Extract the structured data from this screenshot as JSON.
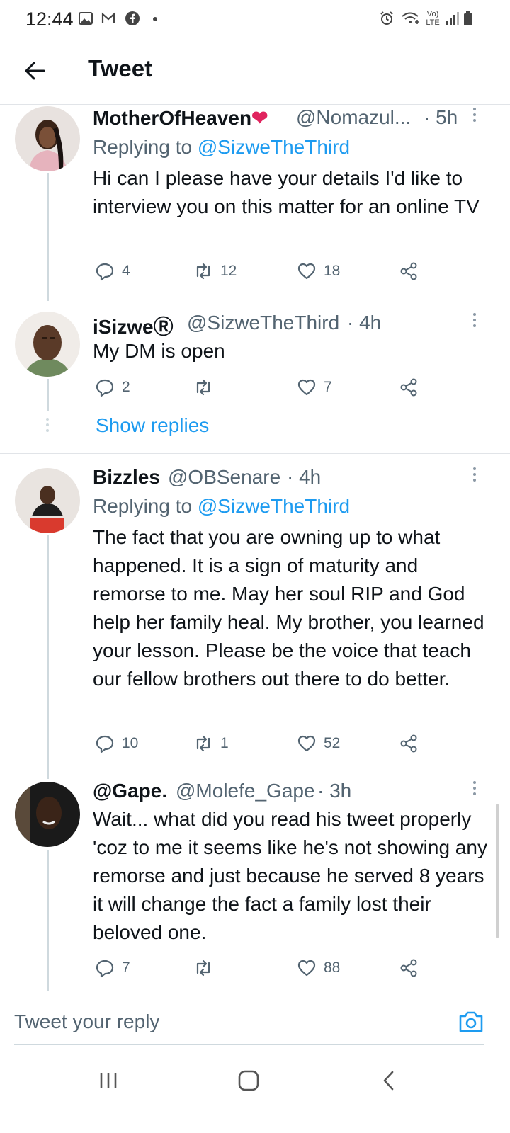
{
  "status_bar": {
    "time": "12:44",
    "left_icons": [
      "gallery-icon",
      "gmail-icon",
      "facebook-icon",
      "dot-icon"
    ],
    "right_icons": [
      "alarm-icon",
      "wifi-icon",
      "volte-icon",
      "signal-icon",
      "battery-icon"
    ],
    "volte_label": "Vo) LTE"
  },
  "header": {
    "title": "Tweet",
    "back_icon": "arrow-left-icon"
  },
  "tweets": [
    {
      "name": "MotherOfHeaven",
      "name_emoji": "❤",
      "handle": "@Nomazul...",
      "time": "· 5h",
      "replying_prefix": "Replying to ",
      "replying_to": "@SizweTheThird",
      "text": "Hi can I please have your details I'd like to interview you on this matter for an online TV",
      "replies": "4",
      "retweets": "12",
      "likes": "18"
    },
    {
      "name": "iSizwe",
      "name_mark": "Ⓡ",
      "handle": "@SizweTheThird",
      "time": "· 4h",
      "text": "My DM is open",
      "replies": "2",
      "retweets": "",
      "likes": "7"
    },
    {
      "name": "Bizzles",
      "handle": "@OBSenare",
      "time": "· 4h",
      "replying_prefix": "Replying to ",
      "replying_to": "@SizweTheThird",
      "text": "The fact that you are owning up to what happened. It is a sign of maturity and remorse to me. May her soul RIP and God help her family heal. My brother, you learned your lesson. Please be the voice that teach our fellow brothers out there to do better.",
      "replies": "10",
      "retweets": "1",
      "likes": "52"
    },
    {
      "name": "@Gape.",
      "handle": "@Molefe_Gape",
      "time": "· 3h",
      "text": "Wait... what did you read his tweet properly 'coz to me it seems like he's not showing any remorse and just because he served 8 years it will change the fact a family lost their beloved one.",
      "replies": "7",
      "retweets": "",
      "likes": "88"
    }
  ],
  "show_replies": "Show replies",
  "compose": {
    "placeholder": "Tweet your reply",
    "camera_icon": "camera-icon"
  },
  "nav": [
    "recent-apps-icon",
    "home-icon",
    "back-icon"
  ],
  "colors": {
    "accent": "#1d9bf0",
    "muted": "#536471",
    "heart": "#e0245e"
  }
}
